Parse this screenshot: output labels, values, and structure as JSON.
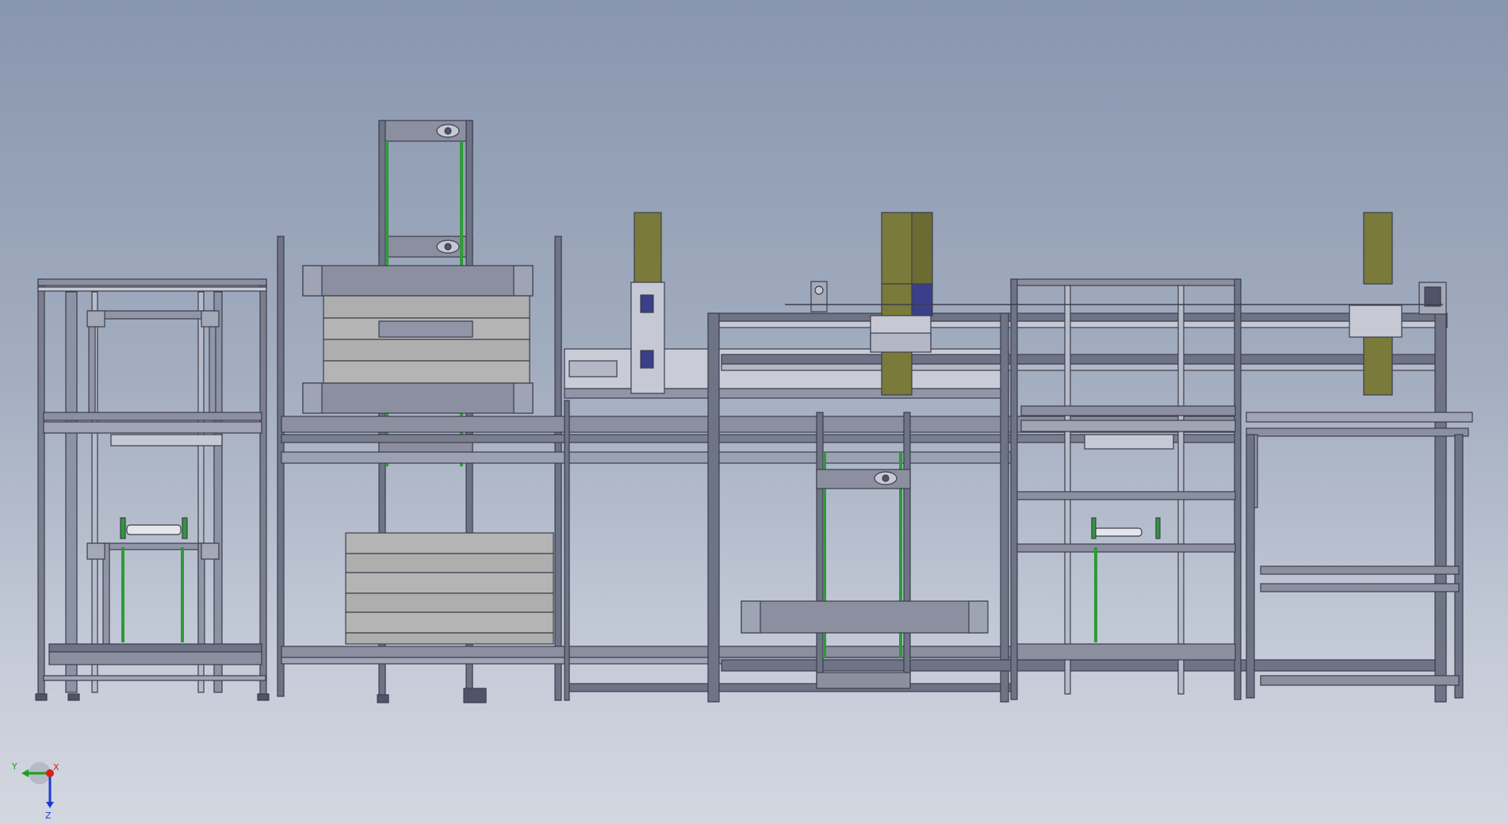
{
  "colors": {
    "background_top": "#8896ae",
    "background_bottom": "#d3d7e0",
    "frame": "#4a4e5c",
    "frame_light": "#a4a9b8",
    "frame_face": "#8b8fa0",
    "beam_face": "#7f8399",
    "panel_gray": "#aeaeae",
    "guide_green": "#2e9a3a",
    "actuator_olive": "#7a7a3a",
    "actuator_blue": "#3a3f8a",
    "triad_x": "#d42020",
    "triad_y": "#1aa01a",
    "triad_z": "#1a3ad4"
  },
  "triad": {
    "x_label": "X",
    "y_label": "Y",
    "z_label": "Z"
  }
}
